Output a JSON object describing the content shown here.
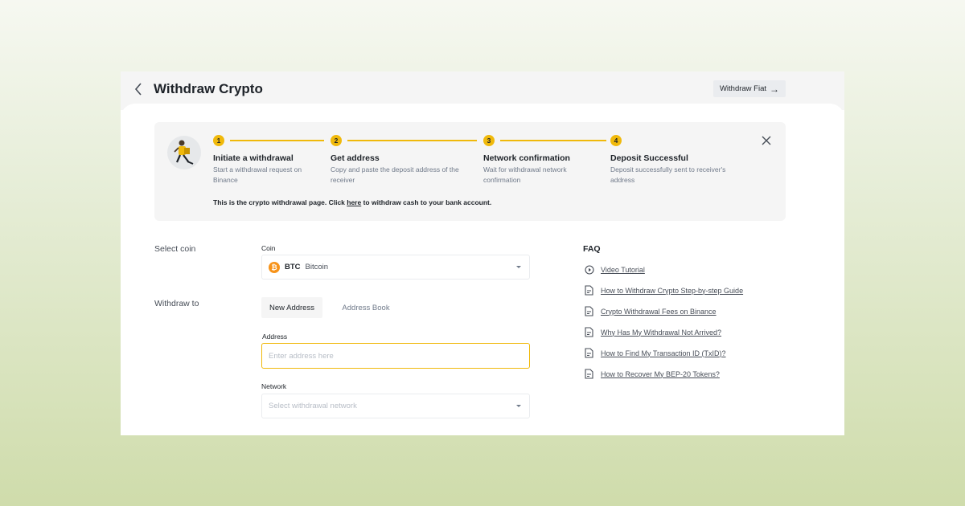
{
  "header": {
    "title": "Withdraw Crypto",
    "fiat_button": "Withdraw Fiat",
    "fiat_arrow": "→"
  },
  "steps": [
    {
      "num": "1",
      "title": "Initiate a withdrawal",
      "desc1": "Start a withdrawal request on",
      "desc2": "Binance"
    },
    {
      "num": "2",
      "title": "Get address",
      "desc1": "Copy and paste the deposit address of the",
      "desc2": "receiver"
    },
    {
      "num": "3",
      "title": "Network confirmation",
      "desc1": "Wait for withdrawal network",
      "desc2": "confirmation"
    },
    {
      "num": "4",
      "title": "Deposit Successful",
      "desc1": "Deposit successfully sent to receiver's",
      "desc2": "address"
    }
  ],
  "notice": {
    "before": "This is the crypto withdrawal page. Click ",
    "link": "here",
    "after": " to withdraw cash to your bank account."
  },
  "form": {
    "select_coin_label": "Select coin",
    "coin_label": "Coin",
    "coin_symbol": "BTC",
    "coin_name": "Bitcoin",
    "withdraw_to_label": "Withdraw to",
    "tabs": [
      "New Address",
      "Address Book"
    ],
    "address_label": "Address",
    "address_placeholder": "Enter address here",
    "address_value": "",
    "network_label": "Network",
    "network_placeholder": "Select withdrawal network"
  },
  "faq": {
    "title": "FAQ",
    "items": [
      {
        "label": "Video Tutorial",
        "icon": "play-circle-icon"
      },
      {
        "label": "How to Withdraw Crypto Step-by-step Guide",
        "icon": "document-icon"
      },
      {
        "label": "Crypto Withdrawal Fees on Binance",
        "icon": "document-icon"
      },
      {
        "label": "Why Has My Withdrawal Not Arrived?",
        "icon": "document-icon"
      },
      {
        "label": "How to Find My Transaction ID (TxID)?",
        "icon": "document-icon"
      },
      {
        "label": "How to Recover My BEP-20 Tokens?",
        "icon": "document-icon"
      }
    ]
  },
  "colors": {
    "accent": "#f0b90b",
    "btc": "#f7931a",
    "text": "#1e2329",
    "muted": "#707a8a"
  }
}
